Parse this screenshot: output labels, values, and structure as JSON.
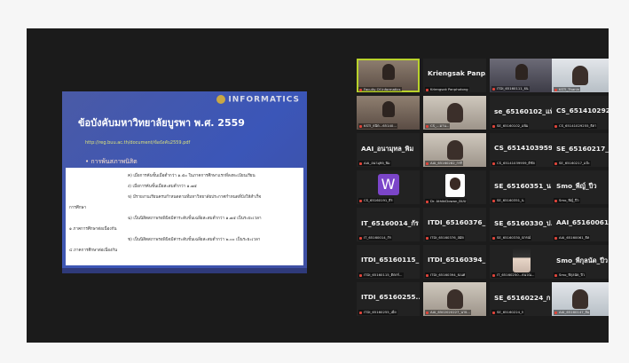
{
  "slide": {
    "logo": "INFORMATICS",
    "title": "ข้อบังคับมหาวิทยาลัยบูรพา พ.ศ. 2559",
    "url": "http://reg.buu.ac.th/document/ข้อบังคับ2559.pdf",
    "bullet": "• การพ้นสภาพนิสิต",
    "lines": [
      "ค) เมื่อการค้นขั้นเมื่อต่ำกว่า ๑.๕๐ ในภาคการศึกษาแรกที่ลงทะเบียนเรียน",
      "ง) เมื่อการค้นขั้นเมื่อสะสมต่ำกว่า ๑.๗๕",
      "จ) มีรายงานเรียนครบกำหนดตามที่มหาวิทยาลัยประกาศกำหนดที่บังให้สำเร็จ",
      "การศึกษา",
      "ฉ) เป็นนิสิตสภาพรอพินิจมีค่าระดับขั้นเฉลี่ยสะสมต่ำกว่า ๑.๗๕ เป็นระยะเวลา",
      "๑ ภาคการศึกษาต่อเนื่องกัน",
      "ช) เป็นนิสิตสภาพรอพินิจมีค่าระดับขั้นเฉลี่ยสะสมต่ำกว่า ๒.๐๐ เป็นระยะเวลา",
      "๔ ภาคการศึกษาต่อเนื่องกัน"
    ]
  },
  "participants": [
    {
      "name": "",
      "caption": "Faculty Of Informatics",
      "kind": "video-active"
    },
    {
      "name": "Kriengsak  Panp...",
      "caption": "Kriengsak Panphotong",
      "kind": "name"
    },
    {
      "name": "",
      "caption": "ITDI_65160111_ธน",
      "kind": "video"
    },
    {
      "name": "",
      "caption": "KSTI_Thanin",
      "kind": "video"
    },
    {
      "name": "",
      "caption": "KSTI_ธนิต...65140...",
      "kind": "video"
    },
    {
      "name": "",
      "caption": "CS_...มาน...",
      "kind": "video"
    },
    {
      "name": "se_65160102_แพ้ม",
      "caption": "SE_65160102_แพ้ม",
      "kind": "name"
    },
    {
      "name": "CS_65141029255...",
      "caption": "CS_65141029255_ธิดา",
      "kind": "name"
    },
    {
      "name": "AAI_อนามุทล_พิม",
      "caption": "AAI_อนามุทล_พิม",
      "kind": "name"
    },
    {
      "name": "",
      "caption": "AAI_65160282_กรกิ",
      "kind": "video"
    },
    {
      "name": "CS_6514103959...",
      "caption": "CS_65141039959_ติชัย",
      "kind": "name"
    },
    {
      "name": "SE_65160217_แป้",
      "caption": "SE_65160217_แป้ะ",
      "kind": "name"
    },
    {
      "name": "",
      "caption": "CS_65160191_ธีร",
      "kind": "avatar-w",
      "avatar": "W"
    },
    {
      "name": "",
      "caption": "Dr. AthikiDowan_BUU",
      "kind": "face"
    },
    {
      "name": "SE_65160351_น",
      "caption": "SE_65160351_น",
      "kind": "name"
    },
    {
      "name": "Smo_พีญ์_ปีว",
      "caption": "Smo_พีญ์_ปีว",
      "kind": "name"
    },
    {
      "name": "IT_65160014_กัร",
      "caption": "IT_65160014_กัร",
      "kind": "name"
    },
    {
      "name": "ITDI_65160376_...",
      "caption": "ITDI_65160376_สมัด",
      "kind": "name"
    },
    {
      "name": "SE_65160330_ป...",
      "caption": "SE_65160330_ปกรณ์",
      "kind": "name"
    },
    {
      "name": "AAI_65160061_...",
      "caption": "AAI_65160061_ธิด",
      "kind": "name"
    },
    {
      "name": "ITDI_65160115_...",
      "caption": "ITDI_65160115_ติตกร์...",
      "kind": "name"
    },
    {
      "name": "ITDI_65160394_...",
      "caption": "ITDI_65160394_ธเนศ",
      "kind": "name"
    },
    {
      "name": "",
      "caption": "IT_65160250...ธนวณ...",
      "kind": "anime"
    },
    {
      "name": "Smo_พีกุลนัด_ปีว",
      "caption": "Smo_พีกุลนัด_ปีว",
      "kind": "name"
    },
    {
      "name": "ITDI_65160255...",
      "caption": "ITDI_65160255_เมี่ย",
      "kind": "name"
    },
    {
      "name": "",
      "caption": "AAI_6502020227_นาย...",
      "kind": "video"
    },
    {
      "name": "SE_65160224_ก",
      "caption": "SE_65160224_ก",
      "kind": "name"
    },
    {
      "name": "",
      "caption": "AAI_65160147_ฮิม",
      "kind": "video"
    }
  ]
}
